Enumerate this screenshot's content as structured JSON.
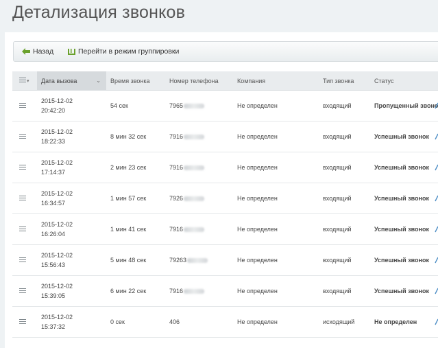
{
  "page": {
    "title": "Детализация звонков"
  },
  "toolbar": {
    "back_label": "Назад",
    "group_label": "Перейти в режим группировки",
    "back_icon": "arrow-left-icon",
    "group_icon": "group-icon"
  },
  "colors": {
    "accent_green": "#6aa12c",
    "header_bg": "#e9ecee",
    "sorted_header_bg": "#d6dadd"
  },
  "table": {
    "columns": [
      "Дата вызова",
      "Время звонка",
      "Номер телефона",
      "Компания",
      "Тип звонка",
      "Статус"
    ],
    "rows": [
      {
        "date": "2015-12-02",
        "time": "20:42:20",
        "duration": "54 сек",
        "phone": "7965",
        "company": "Не определен",
        "type": "входящий",
        "status": "Пропущенный звонок"
      },
      {
        "date": "2015-12-02",
        "time": "18:22:33",
        "duration": "8 мин 32 сек",
        "phone": "7916",
        "company": "Не определен",
        "type": "входящий",
        "status": "Успешный звонок"
      },
      {
        "date": "2015-12-02",
        "time": "17:14:37",
        "duration": "2 мин 23 сек",
        "phone": "7916",
        "company": "Не определен",
        "type": "входящий",
        "status": "Успешный звонок"
      },
      {
        "date": "2015-12-02",
        "time": "16:34:57",
        "duration": "1 мин 57 сек",
        "phone": "7926",
        "company": "Не определен",
        "type": "входящий",
        "status": "Успешный звонок"
      },
      {
        "date": "2015-12-02",
        "time": "16:26:04",
        "duration": "1 мин 41 сек",
        "phone": "7916",
        "company": "Не определен",
        "type": "входящий",
        "status": "Успешный звонок"
      },
      {
        "date": "2015-12-02",
        "time": "15:56:43",
        "duration": "5 мин 48 сек",
        "phone": "79263",
        "company": "Не определен",
        "type": "входящий",
        "status": "Успешный звонок"
      },
      {
        "date": "2015-12-02",
        "time": "15:39:05",
        "duration": "6 мин 22 сек",
        "phone": "7916",
        "company": "Не определен",
        "type": "входящий",
        "status": "Успешный звонок"
      },
      {
        "date": "2015-12-02",
        "time": "15:37:32",
        "duration": "0 сек",
        "phone": "406",
        "company": "Не определен",
        "type": "исходящий",
        "status": "Не определен"
      }
    ]
  }
}
